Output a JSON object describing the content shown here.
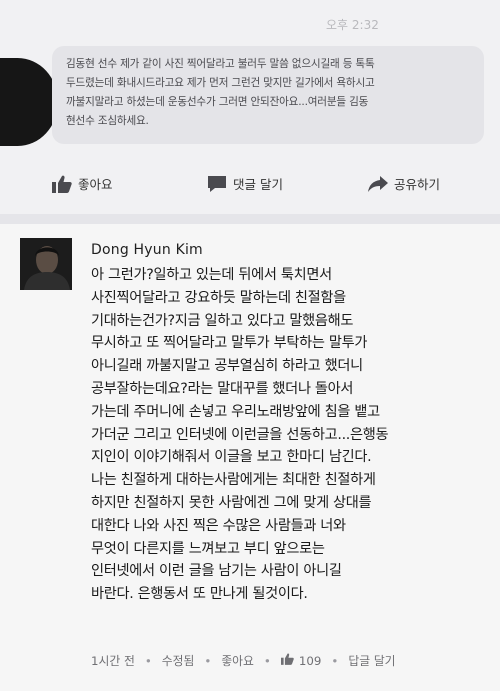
{
  "post": {
    "timestamp": "오후 2:32",
    "message_lines": [
      "김동현 선수 제가 같이 사진 찍어달라고 불러두 말씀 없으시길래 등 톡톡",
      "두드렸는데 화내시드라고요 제가 먼저 그런건 맞지만 길가에서 욕하시고",
      "까불지말라고 하셨는데 운동선수가 그러면 안되잔아요...여러분들 김동",
      "현선수 조심하세요."
    ],
    "actions": [
      {
        "label": "좋아요",
        "icon": "thumbs-up-icon"
      },
      {
        "label": "댓글 달기",
        "icon": "comment-icon"
      },
      {
        "label": "공유하기",
        "icon": "share-icon"
      }
    ]
  },
  "comment": {
    "author": "Dong Hyun Kim",
    "body_lines": [
      "아 그런가?일하고 있는데 뒤에서 툭치면서",
      "사진찍어달라고 강요하듯 말하는데 친절함을",
      "기대하는건가?지금 일하고 있다고 말했음해도",
      "무시하고 또 찍어달라고 말투가 부탁하는 말투가",
      "아니길래 까불지말고 공부열심히 하라고 했더니",
      "공부잘하는데요?라는 말대꾸를 했더나 돌아서",
      "가는데 주머니에 손넣고 우리노래방앞에 침을 뱉고",
      "가더군 그리고 인터넷에 이런글을 선동하고...은행동",
      "지인이 이야기해줘서 이글을 보고 한마디 남긴다.",
      "나는 친절하게 대하는사람에게는 최대한 친절하게",
      "하지만 친절하지 못한 사람에겐 그에 맞게 상대를",
      "대한다 나와 사진 찍은 수많은 사람들과 너와",
      "무엇이 다른지를 느껴보고 부디 앞으로는",
      "인터넷에서 이런 글을 남기는 사람이 아니길",
      "바란다. 은행동서 또 만나게 될것이다."
    ],
    "meta": {
      "time": "1시간 전",
      "edited": "수정됨",
      "like": "좋아요",
      "like_count": "109",
      "reply": "답글 달기"
    }
  },
  "colors": {
    "bubble": "#e4e4e8",
    "background": "#f3f3f3",
    "text": "#1b1b1b",
    "meta": "#6f6f73"
  }
}
